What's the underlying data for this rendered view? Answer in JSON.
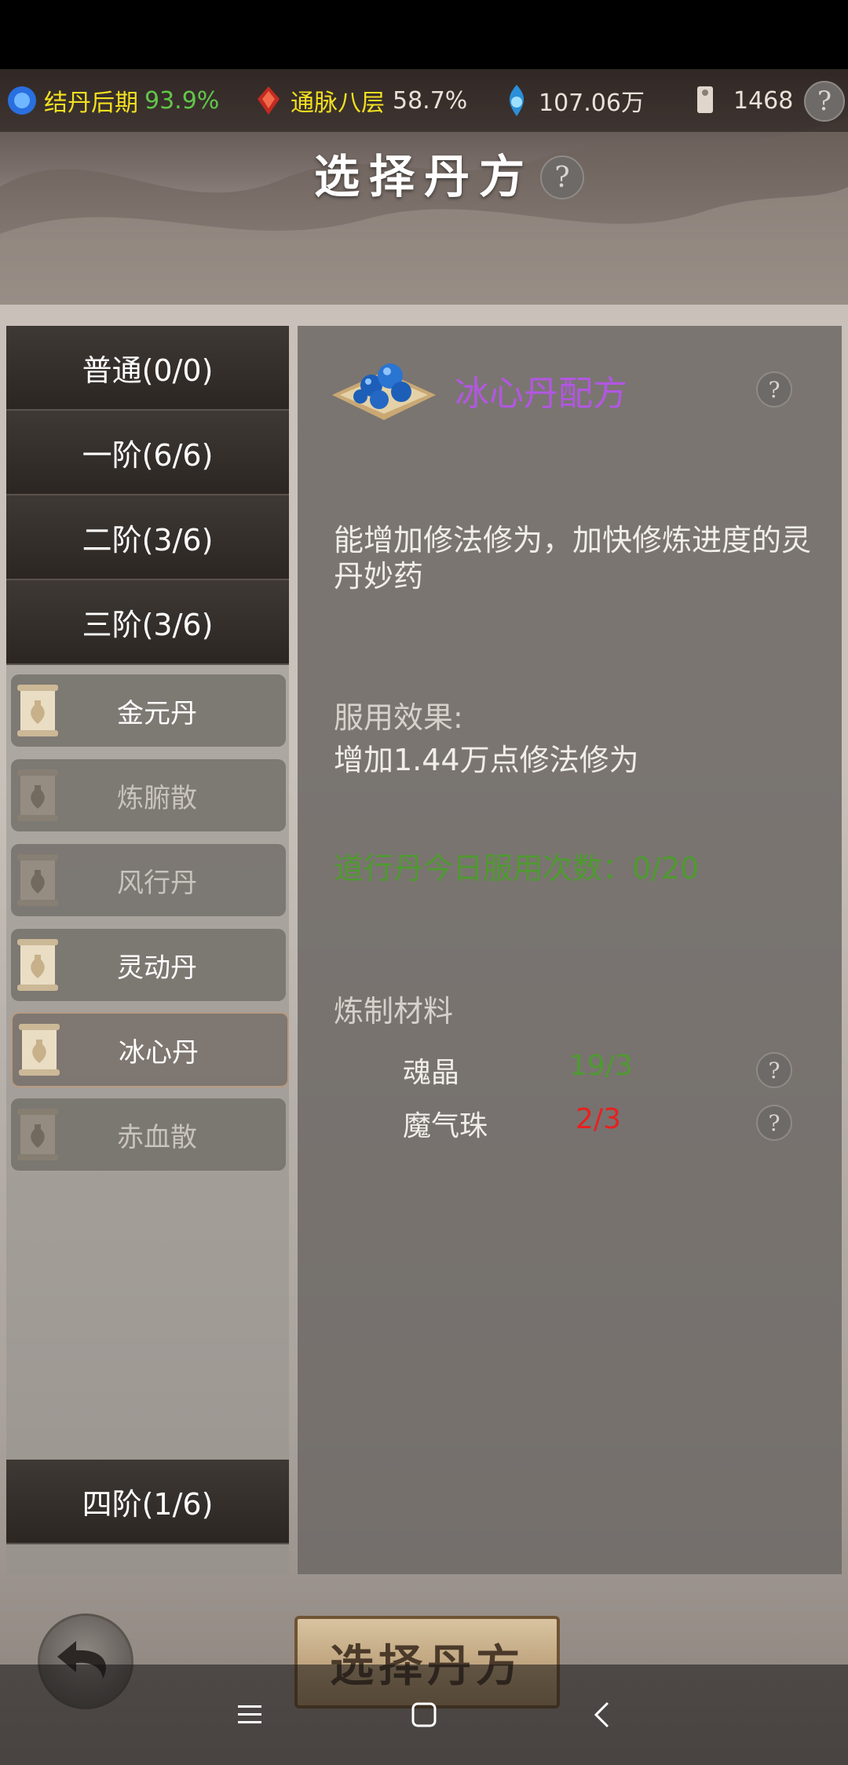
{
  "status": {
    "realm_label": "结丹后期",
    "realm_pct": "93.9%",
    "meridian_label": "通脉八层",
    "meridian_pct": "58.7%",
    "spirit_stones": "107.06万",
    "tokens": "1468"
  },
  "title": "选择丹方",
  "tiers": [
    {
      "label": "普通(0/0)"
    },
    {
      "label": "一阶(6/6)"
    },
    {
      "label": "二阶(3/6)"
    },
    {
      "label": "三阶(3/6)"
    },
    {
      "label": "四阶(1/6)"
    }
  ],
  "recipes": [
    {
      "name": "金元丹",
      "unlocked": true
    },
    {
      "name": "炼腑散",
      "unlocked": false
    },
    {
      "name": "风行丹",
      "unlocked": false
    },
    {
      "name": "灵动丹",
      "unlocked": true
    },
    {
      "name": "冰心丹",
      "unlocked": true,
      "selected": true
    },
    {
      "name": "赤血散",
      "unlocked": false
    }
  ],
  "detail": {
    "recipe_title": "冰心丹配方",
    "description": "能增加修法修为，加快修炼进度的灵丹妙药",
    "effect_header": "服用效果:",
    "effect_text": "增加1.44万点修法修为",
    "daily_uses": "道行丹今日服用次数：0/20",
    "materials_header": "炼制材料",
    "materials": [
      {
        "name": "魂晶",
        "qty": "19/3",
        "color": "#4f9a30"
      },
      {
        "name": "魔气珠",
        "qty": "2/3",
        "color": "#e82020"
      }
    ]
  },
  "bottom": {
    "select_button": "选择丹方"
  },
  "colors": {
    "accent_purple": "#b257e0",
    "ok_green": "#4f9a30",
    "warn_red": "#e82020",
    "status_yellow": "#f2e020"
  }
}
